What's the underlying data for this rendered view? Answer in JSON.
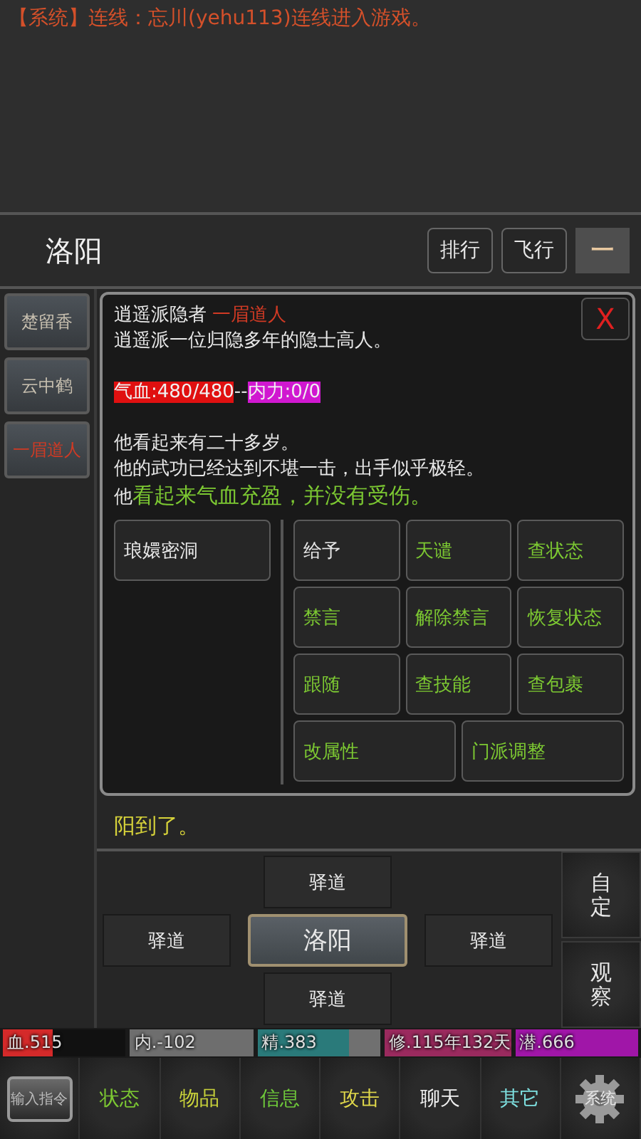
{
  "chat": {
    "messages": [
      "【系统】连线：忘川(yehu113)连线进入游戏。"
    ]
  },
  "location_bar": {
    "title": "洛阳",
    "buttons": [
      "排行",
      "飞行"
    ],
    "minimize": "一"
  },
  "npcs": [
    {
      "label": "楚留香",
      "selected": false
    },
    {
      "label": "云中鹤",
      "selected": false
    },
    {
      "label": "一眉道人",
      "selected": true
    }
  ],
  "dialog": {
    "close": "X",
    "paragraphs": [
      [
        [
          {
            "kind": "normal",
            "text": "逍遥派隐者 "
          },
          {
            "kind": "red",
            "text": "一眉道人"
          }
        ],
        [
          {
            "kind": "normal",
            "text": "逍遥派一位归隐多年的隐士高人。"
          }
        ]
      ],
      [
        [
          {
            "kind": "hp",
            "text": "气血:480/480"
          },
          {
            "kind": "normal",
            "text": "--"
          },
          {
            "kind": "mp",
            "text": "内力:0/0"
          }
        ]
      ],
      [
        [
          {
            "kind": "normal",
            "text": "他看起来有二十多岁。"
          }
        ],
        [
          {
            "kind": "normal",
            "text": "他的武功已经达到不堪一击，出手似乎极轻。"
          }
        ],
        [
          {
            "kind": "normal",
            "text": "他"
          },
          {
            "kind": "green",
            "text": "看起来气血充盈，并没有受伤。"
          }
        ]
      ]
    ],
    "places": [
      "琅嬛密洞"
    ],
    "actions": [
      {
        "label": "给予",
        "color": "#e8e8e8"
      },
      {
        "label": "天谴",
        "color": "#7cc832"
      },
      {
        "label": "查状态",
        "color": "#7cc832"
      },
      {
        "label": "禁言",
        "color": "#7cc832"
      },
      {
        "label": "解除禁言",
        "color": "#7cc832"
      },
      {
        "label": "恢复状态",
        "color": "#7cc832"
      },
      {
        "label": "跟随",
        "color": "#7cc832"
      },
      {
        "label": "查技能",
        "color": "#7cc832"
      },
      {
        "label": "查包裹",
        "color": "#7cc832"
      },
      {
        "label": "改属性",
        "color": "#7cc832"
      },
      {
        "label": "门派调整",
        "color": "#7cc832"
      }
    ]
  },
  "story": [
    "阳到了。"
  ],
  "map": {
    "north": "驿道",
    "west": "驿道",
    "center": "洛阳",
    "east": "驿道",
    "south": "驿道"
  },
  "side_buttons": [
    "自定",
    "观察"
  ],
  "stats": [
    {
      "label": "血.515",
      "level": 0.4,
      "color": "#d42a2a"
    },
    {
      "label": "内.-102",
      "level": 1,
      "color": "#6e6e6e"
    },
    {
      "label": "精.383",
      "level": 0.75,
      "color": "#2a7a7a"
    },
    {
      "label": "修.115年132天",
      "level": 1,
      "color": "#9a2a5e"
    },
    {
      "label": "潜.666",
      "level": 1,
      "color": "#a016a8"
    }
  ],
  "nav": [
    {
      "kind": "command",
      "label": "输入指令"
    },
    {
      "kind": "text",
      "label": "状态",
      "color": "#7cc832"
    },
    {
      "kind": "text",
      "label": "物品",
      "color": "#c8d23a"
    },
    {
      "kind": "text",
      "label": "信息",
      "color": "#6ec83a"
    },
    {
      "kind": "text",
      "label": "攻击",
      "color": "#e0d84a"
    },
    {
      "kind": "text",
      "label": "聊天",
      "color": "#f0f0f0"
    },
    {
      "kind": "text",
      "label": "其它",
      "color": "#7ee0e0"
    },
    {
      "kind": "gear",
      "label": "系统"
    }
  ]
}
